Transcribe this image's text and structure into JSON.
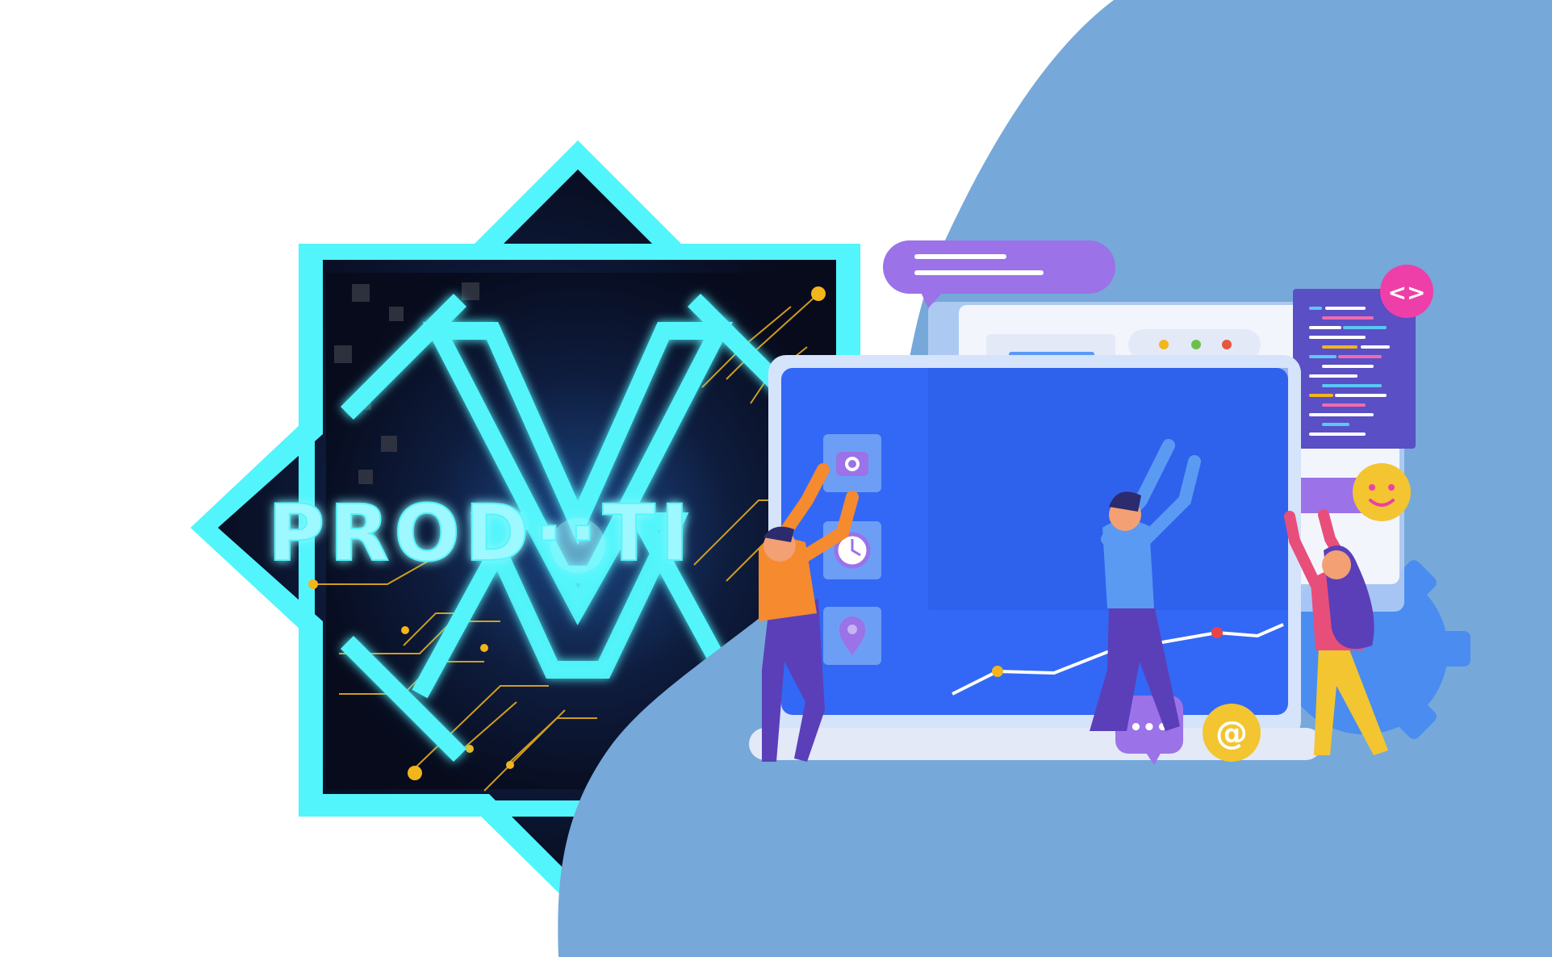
{
  "logo": {
    "wordmark": "PROD··TI",
    "monogram": "X"
  },
  "illustration": {
    "code_badge": "<>",
    "email_badge": "@",
    "chat_dots": "•••"
  },
  "colors": {
    "background": "#ffffff",
    "blob": "#76a8da",
    "neon": "#52f5fb",
    "logo_dark": "#0a1126",
    "circuit": "#f2b51c",
    "laptop_blue": "#3268f5",
    "purple": "#9b72e8",
    "code_panel": "#5a4fc4"
  }
}
